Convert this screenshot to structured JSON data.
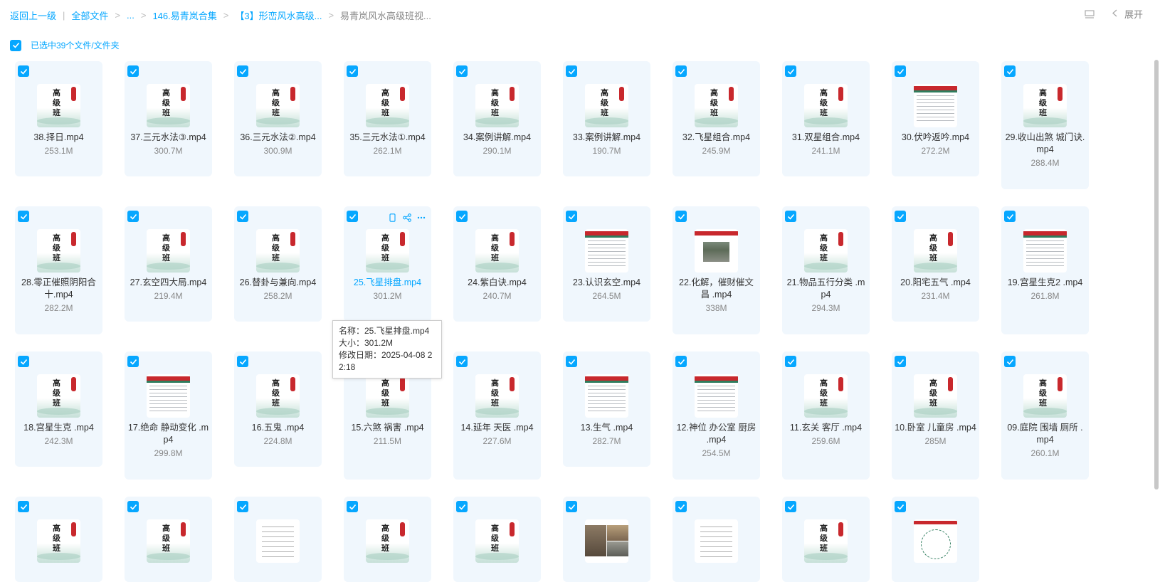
{
  "breadcrumb": {
    "back": "返回上一级",
    "items": [
      "全部文件",
      "...",
      "146.易青岚合集",
      "【3】形峦风水高级...",
      "易青岚风水高级班视..."
    ],
    "sep": ">",
    "divider": "|"
  },
  "header": {
    "expand_label": "展开"
  },
  "selection": {
    "label": "已选中39个文件/文件夹"
  },
  "files": [
    {
      "name": "38.择日.mp4",
      "size": "253.1M",
      "thumb": "book"
    },
    {
      "name": "37.三元水法③.mp4",
      "size": "300.7M",
      "thumb": "book"
    },
    {
      "name": "36.三元水法②.mp4",
      "size": "300.9M",
      "thumb": "book"
    },
    {
      "name": "35.三元水法①.mp4",
      "size": "262.1M",
      "thumb": "book"
    },
    {
      "name": "34.案例讲解.mp4",
      "size": "290.1M",
      "thumb": "book"
    },
    {
      "name": "33.案例讲解.mp4",
      "size": "190.7M",
      "thumb": "book"
    },
    {
      "name": "32.飞星组合.mp4",
      "size": "245.9M",
      "thumb": "book"
    },
    {
      "name": "31.双星组合.mp4",
      "size": "241.1M",
      "thumb": "book"
    },
    {
      "name": "30.伏吟返吟.mp4",
      "size": "272.2M",
      "thumb": "slide"
    },
    {
      "name": "29.收山出煞 城门诀.mp4",
      "size": "288.4M",
      "thumb": "book"
    },
    {
      "name": "28.零正催照阴阳合十.mp4",
      "size": "282.2M",
      "thumb": "book"
    },
    {
      "name": "27.玄空四大局.mp4",
      "size": "219.4M",
      "thumb": "book"
    },
    {
      "name": "26.替卦与兼向.mp4",
      "size": "258.2M",
      "thumb": "book"
    },
    {
      "name": "25.飞星排盘.mp4",
      "size": "301.2M",
      "thumb": "book"
    },
    {
      "name": "24.紫白诀.mp4",
      "size": "240.7M",
      "thumb": "book"
    },
    {
      "name": "23.认识玄空.mp4",
      "size": "264.5M",
      "thumb": "slide"
    },
    {
      "name": "22.化解，催财催文昌 .mp4",
      "size": "338M",
      "thumb": "photo"
    },
    {
      "name": "21.物品五行分类 .mp4",
      "size": "294.3M",
      "thumb": "book"
    },
    {
      "name": "20.阳宅五气 .mp4",
      "size": "231.4M",
      "thumb": "book"
    },
    {
      "name": "19.宫星生克2 .mp4",
      "size": "261.8M",
      "thumb": "slide"
    },
    {
      "name": "18.宫星生克 .mp4",
      "size": "242.3M",
      "thumb": "book"
    },
    {
      "name": "17.绝命 静动变化 .mp4",
      "size": "299.8M",
      "thumb": "slide"
    },
    {
      "name": "16.五鬼 .mp4",
      "size": "224.8M",
      "thumb": "book"
    },
    {
      "name": "15.六煞 祸害 .mp4",
      "size": "211.5M",
      "thumb": "book"
    },
    {
      "name": "14.延年 天医 .mp4",
      "size": "227.6M",
      "thumb": "book"
    },
    {
      "name": "13.生气 .mp4",
      "size": "282.7M",
      "thumb": "slide"
    },
    {
      "name": "12.神位 办公室 厨房 .mp4",
      "size": "254.5M",
      "thumb": "slide"
    },
    {
      "name": "11.玄关 客厅 .mp4",
      "size": "259.6M",
      "thumb": "book"
    },
    {
      "name": "10.卧室 儿童房 .mp4",
      "size": "285M",
      "thumb": "book"
    },
    {
      "name": "09.庭院 围墙 厕所 .mp4",
      "size": "260.1M",
      "thumb": "book"
    },
    {
      "name": "",
      "size": "",
      "thumb": "book"
    },
    {
      "name": "",
      "size": "",
      "thumb": "book"
    },
    {
      "name": "",
      "size": "",
      "thumb": "doc"
    },
    {
      "name": "",
      "size": "",
      "thumb": "book"
    },
    {
      "name": "",
      "size": "",
      "thumb": "book"
    },
    {
      "name": "",
      "size": "",
      "thumb": "photo2"
    },
    {
      "name": "",
      "size": "",
      "thumb": "doc"
    },
    {
      "name": "",
      "size": "",
      "thumb": "book"
    },
    {
      "name": "",
      "size": "",
      "thumb": "map"
    }
  ],
  "thumb_text": {
    "chars": "高级班",
    "seal": ""
  },
  "tooltip": {
    "name_line": "名称：25.飞星排盘.mp4",
    "size_line": "大小：301.2M",
    "date_line": "修改日期：2025-04-08 22:18"
  },
  "colors": {
    "accent": "#06a7ff",
    "card_bg": "#f0f7fd",
    "seal": "#c8282d"
  },
  "icons": {
    "checkbox": "check-icon",
    "phone": "phone-icon",
    "share": "share-icon",
    "more": "more-icon",
    "layout": "layout-icon",
    "chevron": "chevron-left-icon"
  }
}
